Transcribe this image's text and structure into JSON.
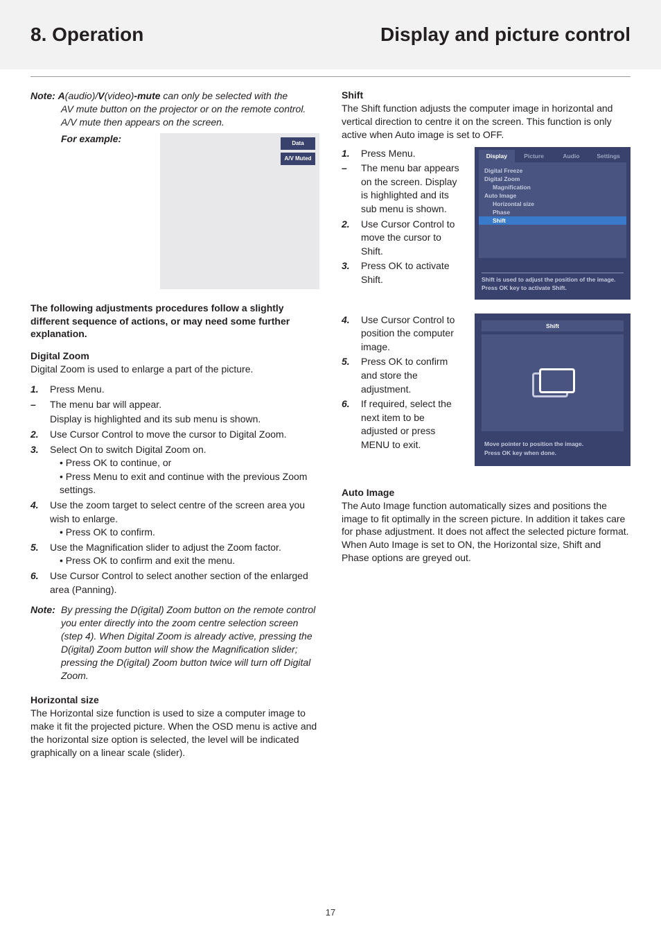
{
  "header": {
    "left": "8. Operation",
    "right": "Display and picture control"
  },
  "left_col": {
    "note": {
      "label": "Note:",
      "prefix": " ",
      "a": "A",
      "mid1": "(audio)/",
      "v": "V",
      "mid2": "(video)",
      "mute": "-mute",
      "line1_rest": " can only be selected with the",
      "line2": "AV mute button on the projector or on the remote control.",
      "line3": "A/V mute then appears on the screen.",
      "for_example": "For example:"
    },
    "example_box": {
      "data": "Data",
      "muted": "A/V Muted"
    },
    "sub_intro": "The following adjustments procedures follow a slightly different sequence of actions, or may need some further explanation.",
    "dz": {
      "title": "Digital Zoom",
      "intro": "Digital Zoom is used to enlarge a part of the picture.",
      "s1": "Press Menu.",
      "s1_dash_a": "The menu bar will appear.",
      "s1_dash_b": "Display is highlighted and its sub menu is shown.",
      "s2": "Use Cursor Control to move the cursor to Digital Zoom.",
      "s3": "Select On to switch Digital Zoom on.",
      "s3_b1": "Press OK to continue, or",
      "s3_b2": "Press Menu to exit and continue with the previous Zoom settings.",
      "s4": "Use the zoom target to select centre of the screen area you wish to enlarge.",
      "s4_b1": "Press OK to confirm.",
      "s5": "Use the Magnification slider to adjust the Zoom factor.",
      "s5_b1": "Press OK to confirm and exit the menu.",
      "s6": "Use Cursor Control to select another section of the enlarged area (Panning)."
    },
    "dz_note": {
      "label": "Note:",
      "body": "By pressing the D(igital) Zoom button on the remote control you enter directly into the zoom centre selection screen (step 4). When Digital Zoom is already active, pressing the D(igital) Zoom button will show the Magnification slider; pressing the D(igital) Zoom button twice will turn off Digital Zoom."
    },
    "hs": {
      "title": "Horizontal size",
      "intro": "The Horizontal size function is used to size a computer image to make it fit the projected picture. When the OSD menu is active and the horizontal size option is selected, the level will be indicated graphically on a linear scale (slider)."
    }
  },
  "right_col": {
    "shift": {
      "title": "Shift",
      "intro": "The Shift function adjusts the computer image in horizontal and vertical direction to centre it on the screen. This function is only active when Auto image is set to OFF.",
      "s1": "Press Menu.",
      "s1_dash": "The menu bar appears on the screen. Display is highlighted and its sub menu is shown.",
      "s2": "Use Cursor Control to move the cursor to Shift.",
      "s3": "Press OK to activate Shift.",
      "s4": "Use Cursor Control to position the computer image.",
      "s5": "Press OK to confirm and store the adjustment.",
      "s6": "If required, select the next item to be adjusted or press MENU to exit."
    },
    "menu": {
      "tabs": {
        "t1": "Display",
        "t2": "Picture",
        "t3": "Audio",
        "t4": "Settings"
      },
      "items": {
        "i1": "Digital Freeze",
        "i2": "Digital Zoom",
        "i3": "Magnification",
        "i4": "Auto Image",
        "i5": "Horizontal size",
        "i6": "Phase",
        "i7": "Shift"
      },
      "foot1": "Shift is used to adjust the position of the image.",
      "foot2": "Press OK key to activate Shift."
    },
    "shift_screen": {
      "title": "Shift",
      "foot1": "Move pointer to position the image.",
      "foot2": "Press OK key when done."
    },
    "auto_image": {
      "title": "Auto Image",
      "intro": "The Auto Image function automatically sizes and positions the image to fit optimally in the screen picture. In addition it takes care for phase adjustment. It does not affect the selected picture format. When Auto Image is set to ON, the Horizontal size, Shift and Phase options are greyed out."
    }
  },
  "page_number": "17"
}
